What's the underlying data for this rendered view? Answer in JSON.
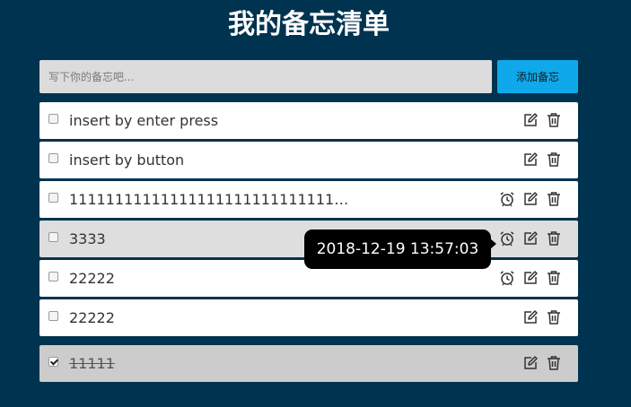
{
  "page": {
    "title": "我的备忘清单"
  },
  "composer": {
    "placeholder": "写下你的备忘吧...",
    "add_label": "添加备忘"
  },
  "todos": [
    {
      "text": "insert by enter press",
      "checked": false,
      "has_alarm": false
    },
    {
      "text": "insert by button",
      "checked": false,
      "has_alarm": false
    },
    {
      "text": "11111111111111111111111111111…",
      "checked": false,
      "has_alarm": true
    },
    {
      "text": "3333",
      "checked": false,
      "has_alarm": true
    },
    {
      "text": "22222",
      "checked": false,
      "has_alarm": true
    },
    {
      "text": "22222",
      "checked": false,
      "has_alarm": false
    },
    {
      "text": "11111",
      "checked": true,
      "has_alarm": false
    }
  ],
  "tooltip": {
    "text": "2018-12-19 13:57:03"
  },
  "icons": {
    "alarm": "alarm-clock-icon",
    "edit": "edit-icon",
    "delete": "trash-icon"
  },
  "colors": {
    "background": "#00334f",
    "accent": "#0fa8ea",
    "row": "#ffffff",
    "row_done": "#cccccc"
  }
}
